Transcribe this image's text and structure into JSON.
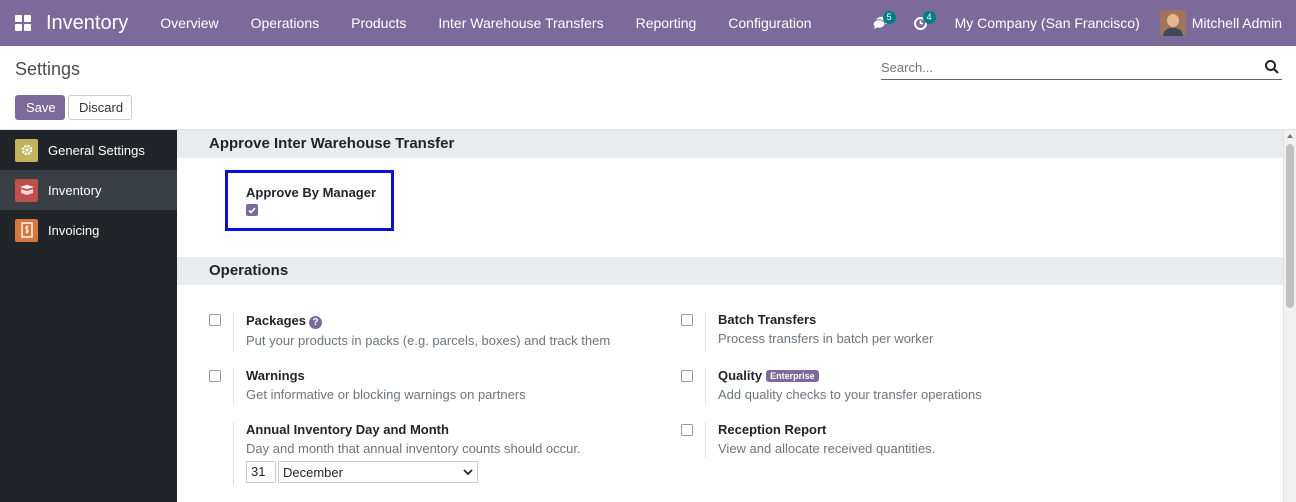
{
  "navbar": {
    "app_name": "Inventory",
    "menu": [
      "Overview",
      "Operations",
      "Products",
      "Inter Warehouse Transfers",
      "Reporting",
      "Configuration"
    ],
    "messages_count": "5",
    "activities_count": "4",
    "company": "My Company (San Francisco)",
    "user": "Mitchell Admin",
    "bg_color": "#7c6a9b"
  },
  "control_panel": {
    "title": "Settings",
    "search_placeholder": "Search...",
    "save_label": "Save",
    "discard_label": "Discard"
  },
  "sidebar": {
    "items": [
      {
        "label": "General Settings",
        "icon": "gear-icon",
        "active": false
      },
      {
        "label": "Inventory",
        "icon": "inventory-box-icon",
        "active": true
      },
      {
        "label": "Invoicing",
        "icon": "invoice-icon",
        "active": false
      }
    ]
  },
  "sections": {
    "approve": {
      "heading": "Approve Inter Warehouse Transfer",
      "setting_label": "Approve By Manager",
      "checked": true
    },
    "operations": {
      "heading": "Operations",
      "packages": {
        "title": "Packages",
        "desc": "Put your products in packs (e.g. parcels, boxes) and track them",
        "checked": false
      },
      "batch": {
        "title": "Batch Transfers",
        "desc": "Process transfers in batch per worker",
        "checked": false
      },
      "warnings": {
        "title": "Warnings",
        "desc": "Get informative or blocking warnings on partners",
        "checked": false
      },
      "quality": {
        "title": "Quality",
        "badge": "Enterprise",
        "desc": "Add quality checks to your transfer operations",
        "checked": false
      },
      "annual": {
        "title": "Annual Inventory Day and Month",
        "desc": "Day and month that annual inventory counts should occur.",
        "day": "31",
        "month": "December"
      },
      "reception": {
        "title": "Reception Report",
        "desc": "View and allocate received quantities.",
        "checked": false
      }
    }
  }
}
